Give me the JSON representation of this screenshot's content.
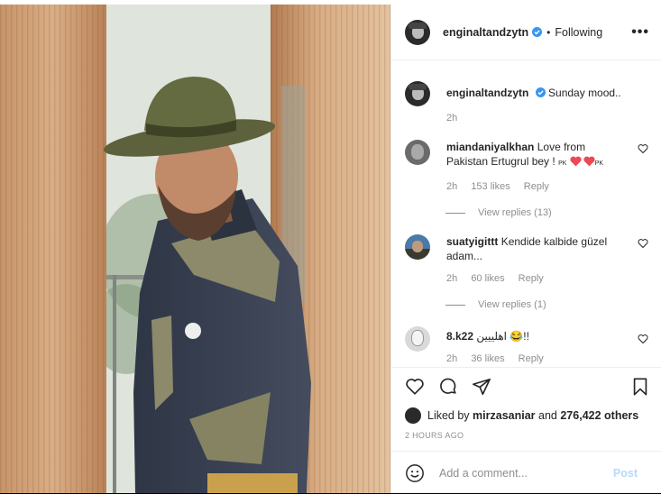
{
  "post": {
    "username": "enginaltandzytn",
    "follow_status": "Following",
    "more_label": "•••"
  },
  "caption": {
    "username": "enginaltandzytn",
    "text": "Sunday mood..",
    "time": "2h"
  },
  "comments": [
    {
      "username": "miandaniyalkhan",
      "text_a": "Love from Pakistan Ertugrul bey ! ",
      "flag1": "PK",
      "flag2": "PK",
      "time": "2h",
      "likes": "153 likes",
      "reply": "Reply",
      "view_replies": "View replies (13)"
    },
    {
      "username": "suatyigittt",
      "text": "Kendide kalbide güzel adam...",
      "time": "2h",
      "likes": "60 likes",
      "reply": "Reply",
      "view_replies": "View replies (1)"
    },
    {
      "username": "8.k22",
      "text": "اهلييين 😂!!",
      "time": "2h",
      "likes": "36 likes",
      "reply": "Reply"
    }
  ],
  "likes": {
    "prefix": "Liked by ",
    "user": "mirzasaniar",
    "middle": " and ",
    "count": "276,422 others"
  },
  "timestamp": "2 HOURS AGO",
  "add_comment": {
    "placeholder": "Add a comment...",
    "post_label": "Post"
  },
  "colors": {
    "verified": "#3897f0",
    "heart_red": "#ed4956",
    "post_disabled": "#b3dbff"
  }
}
